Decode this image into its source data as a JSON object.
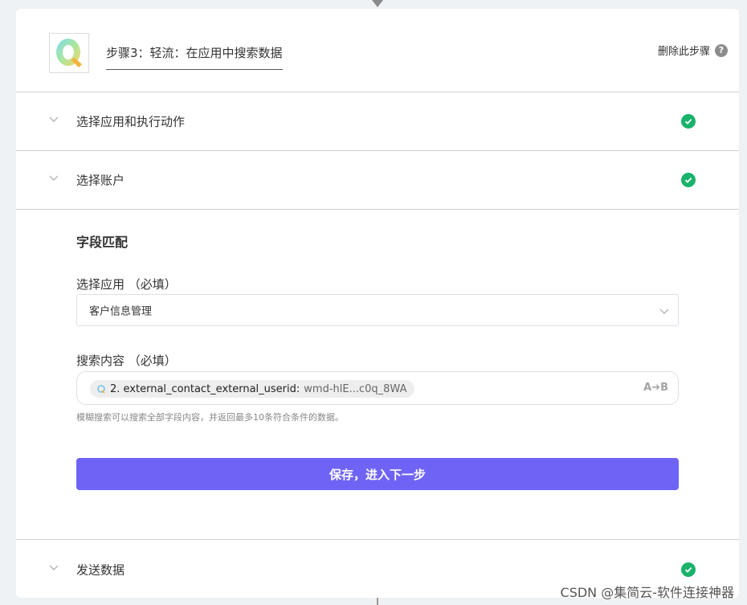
{
  "step": {
    "title": "步骤3：轻流：在应用中搜索数据",
    "delete_label": "删除此步骤",
    "help_glyph": "?"
  },
  "sections": {
    "choose_app_action": "选择应用和执行动作",
    "choose_account": "选择账户",
    "send_data": "发送数据"
  },
  "mapping": {
    "title": "字段匹配",
    "app_field": {
      "label": "选择应用 （必填）",
      "value": "客户信息管理"
    },
    "search_field": {
      "label": "搜索内容 （必填）",
      "token_key": "2. external_contact_external_userid:",
      "token_value": "wmd-hlE...c0q_8WA",
      "ab_label": "A➔B",
      "hint": "模糊搜索可以搜索全部字段内容，并返回最多10条符合条件的数据。"
    },
    "save_label": "保存，进入下一步"
  },
  "colors": {
    "accent": "#6e63f5",
    "success": "#19b26b"
  },
  "watermark": "CSDN @集简云-软件连接神器"
}
